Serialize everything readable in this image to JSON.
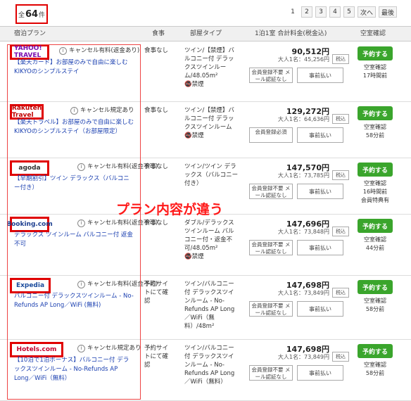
{
  "header": {
    "count_label": "全",
    "count": "64",
    "count_unit": "件",
    "pages": [
      "1",
      "2",
      "3",
      "4",
      "5"
    ],
    "next": "次へ",
    "last": "最後"
  },
  "columns": {
    "plan": "宿泊プラン",
    "meal": "食事",
    "room": "部屋タイプ",
    "price": "1泊1室 合計料金(税金込)",
    "availability": "空室確認"
  },
  "rows": [
    {
      "site": "YAHOO! TRAVEL",
      "cancel": "キャンセル有料(返金あり)",
      "plan": "【楽天カード】お部屋のみで自由に楽しむKIKYOのシンプルステイ",
      "meal": "食事なし",
      "room": "ツイン/【禁煙】バルコニー付 デラックスツインルーム/48.05m²",
      "smoking": "禁煙",
      "price": "90,512円",
      "per_person": "大人1名：45,256円",
      "tax": "税込",
      "member": "会員登録不要 メール認証なし",
      "prepay": "事前払い",
      "book": "予約する",
      "avail": "空室確認",
      "time": "17時間前"
    },
    {
      "site": "Rakuten Travel",
      "cancel": "キャンセル規定あり",
      "plan": "【楽天トラベル】お部屋のみで自由に楽しむKIKYOのシンプルステイ（お部屋限定）",
      "meal": "食事なし",
      "room": "ツイン/【禁煙】バルコニー付 デラックスツインルーム",
      "smoking": "禁煙",
      "price": "129,272円",
      "per_person": "大人1名：64,636円",
      "tax": "税込",
      "member": "会員登録必須",
      "prepay": "事前払い",
      "book": "予約する",
      "avail": "空室確認",
      "time": "58分前"
    },
    {
      "site": "agoda",
      "cancel": "キャンセル有料(返金不可)",
      "plan": "【早期割引】ツイン デラックス（バルコニー付き）",
      "meal": "食事なし",
      "room": "ツイン/ツイン デラックス（バルコニー付き）",
      "smoking": "",
      "price": "147,570円",
      "per_person": "大人1名：73,785円",
      "tax": "税込",
      "member": "会員登録不要 メール認証なし",
      "prepay": "事前払い",
      "book": "予約する",
      "avail": "空室確認",
      "time": "16時間前",
      "extra": "会員特典有"
    },
    {
      "site": "Booking.com",
      "cancel": "キャンセル有料(返金不可)",
      "plan": "デラックス ツインルーム バルコニー付 返金不可",
      "meal": "食事なし",
      "room": "ダブル/デラックス ツインルーム バルコニー付・返金不可/48.05m²",
      "smoking": "禁煙",
      "price": "147,696円",
      "per_person": "大人1名：73,848円",
      "tax": "税込",
      "member": "会員登録不要 メール認証なし",
      "prepay": "事前払い",
      "book": "予約する",
      "avail": "空室確認",
      "time": "44分前"
    },
    {
      "site": "Expedia",
      "cancel": "キャンセル有料(返金不可)",
      "plan": "バルコニー付 デラックスツインルーム - No-Refunds AP Long／WiFi (無料)",
      "meal": "予約サイトにて確認",
      "room": "ツイン/バルコニー付 デラックスツインルーム - No-Refunds AP Long／WiFi（無料）/48m²",
      "smoking": "",
      "price": "147,698円",
      "per_person": "大人1名：73,849円",
      "tax": "税込",
      "member": "会員登録不要 メール認証なし",
      "prepay": "事前払い",
      "book": "予約する",
      "avail": "空室確認",
      "time": "58分前"
    },
    {
      "site": "Hotels.com",
      "cancel": "キャンセル規定あり",
      "plan": "【10泊で1泊ボーナス】バルコニー付 デラックスツインルーム - No-Refunds AP Long／WiFi（無料）",
      "meal": "予約サイトにて確認",
      "room": "ツイン/バルコニー付 デラックスツインルーム - No-Refunds AP Long／WiFi（無料）",
      "smoking": "",
      "price": "147,698円",
      "per_person": "大人1名：73,849円",
      "tax": "税込",
      "member": "会員登録不要 メール認証なし",
      "prepay": "事前払い",
      "book": "予約する",
      "avail": "空室確認",
      "time": "58分前"
    }
  ],
  "annotation": "プラン内容が違う",
  "colors": {
    "highlight": "#e00000",
    "book_button": "#3aa52c",
    "link": "#1a3fb0"
  }
}
